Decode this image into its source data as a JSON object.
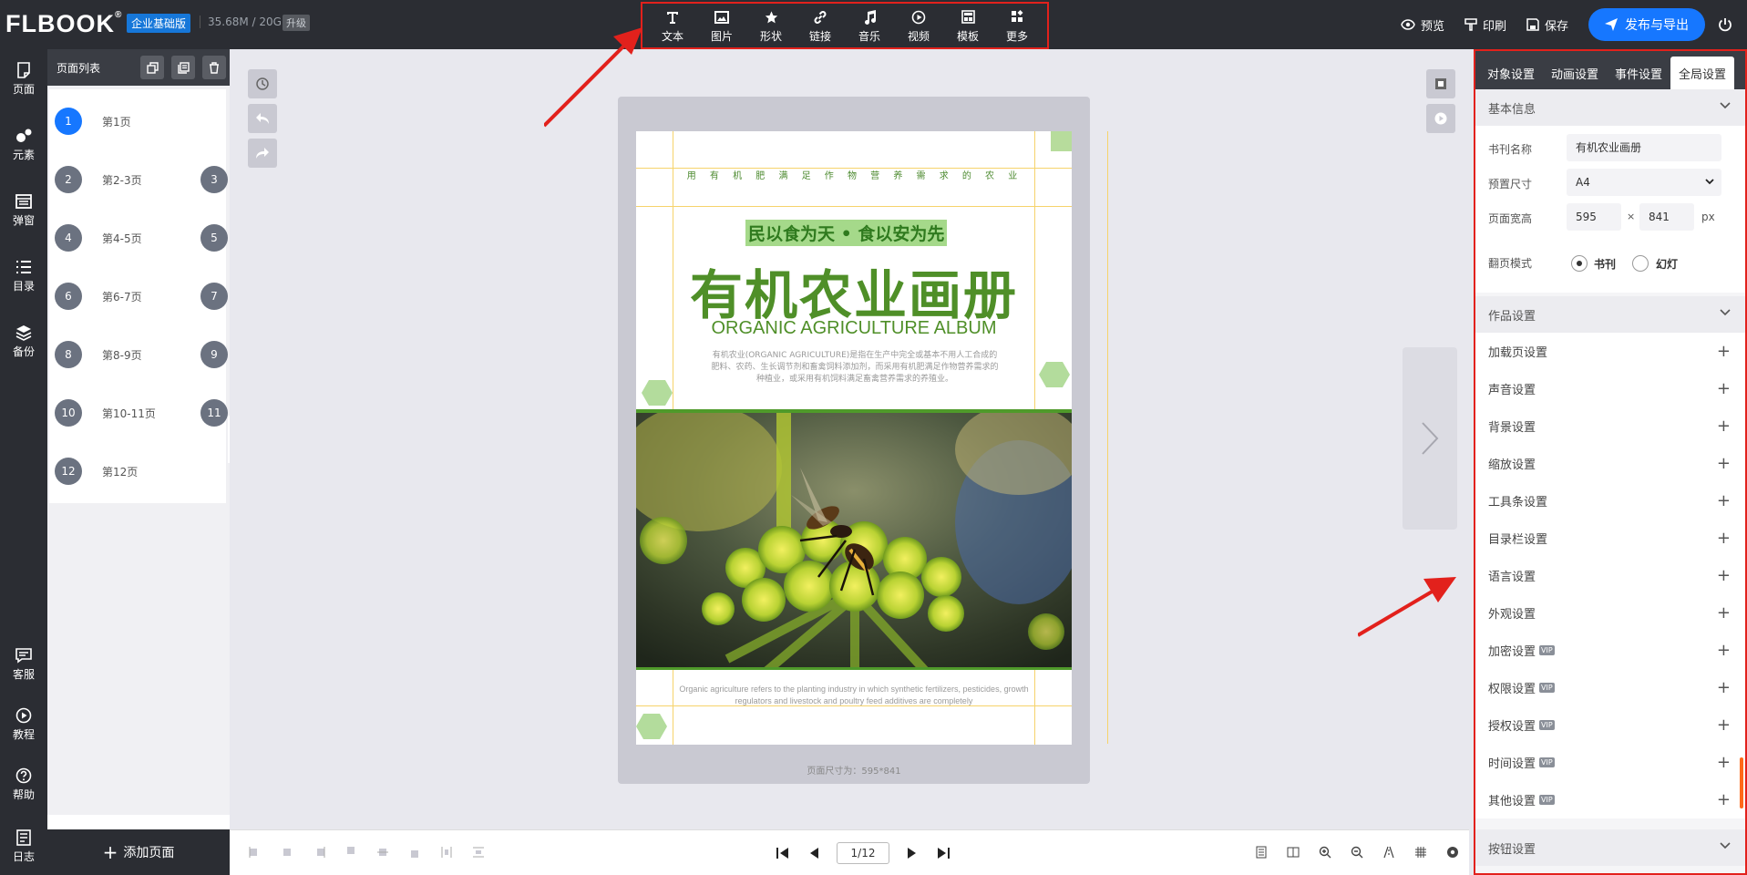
{
  "brand": {
    "logo": "FLBOOK",
    "edition": "企业基础版",
    "storage": "35.68M / 20G",
    "upgrade": "升级"
  },
  "toolbar": [
    {
      "label": "文本",
      "icon": "text-icon"
    },
    {
      "label": "图片",
      "icon": "image-icon"
    },
    {
      "label": "形状",
      "icon": "star-icon"
    },
    {
      "label": "链接",
      "icon": "link-icon"
    },
    {
      "label": "音乐",
      "icon": "music-icon"
    },
    {
      "label": "视频",
      "icon": "video-icon"
    },
    {
      "label": "模板",
      "icon": "template-icon"
    },
    {
      "label": "更多",
      "icon": "more-icon"
    }
  ],
  "actions": {
    "preview": "预览",
    "print": "印刷",
    "save": "保存",
    "publish": "发布与导出"
  },
  "leftnav": [
    {
      "label": "页面",
      "icon": "page-icon"
    },
    {
      "label": "元素",
      "icon": "elements-icon"
    },
    {
      "label": "弹窗",
      "icon": "popup-icon"
    },
    {
      "label": "目录",
      "icon": "list-icon"
    },
    {
      "label": "备份",
      "icon": "layers-icon"
    },
    {
      "label": "客服",
      "icon": "chat-icon"
    },
    {
      "label": "教程",
      "icon": "play-icon"
    },
    {
      "label": "帮助",
      "icon": "help-icon"
    },
    {
      "label": "日志",
      "icon": "log-icon"
    }
  ],
  "pagelist": {
    "title": "页面列表",
    "pages": [
      {
        "left": "1",
        "right": "",
        "label": "第1页"
      },
      {
        "left": "2",
        "right": "3",
        "label": "第2-3页"
      },
      {
        "left": "4",
        "right": "5",
        "label": "第4-5页"
      },
      {
        "left": "6",
        "right": "7",
        "label": "第6-7页"
      },
      {
        "left": "8",
        "right": "9",
        "label": "第8-9页"
      },
      {
        "left": "10",
        "right": "11",
        "label": "第10-11页"
      },
      {
        "left": "12",
        "right": "",
        "label": "第12页"
      }
    ],
    "add": "添加页面"
  },
  "page": {
    "topline": "用 有 机 肥 满 足 作 物 营 养 需 求 的 农 业",
    "slogan": "民以食为天 • 食以安为先",
    "title": "有机农业画册",
    "subtitle": "ORGANIC AGRICULTURE ALBUM",
    "desc": "有机农业(ORGANIC AGRICULTURE)是指在生产中完全或基本不用人工合成的肥料、农药、生长调节剂和畜禽饲料添加剂，而采用有机肥满足作物营养需求的种植业，或采用有机饲料满足畜禽营养需求的养殖业。",
    "footer": "Organic agriculture refers to the planting industry in which synthetic fertilizers, pesticides, growth regulators and livestock and poultry feed additives are completely",
    "size_label": "页面尺寸为：595*841"
  },
  "pager": {
    "current": "1/12"
  },
  "rightpanel": {
    "tabs": [
      "对象设置",
      "动画设置",
      "事件设置",
      "全局设置"
    ],
    "active_tab": 3,
    "basic": {
      "header": "基本信息",
      "name_label": "书刊名称",
      "name_value": "有机农业画册",
      "size_label": "预置尺寸",
      "size_value": "A4",
      "dim_label": "页面宽高",
      "width": "595",
      "height": "841",
      "times": "×",
      "unit": "px",
      "mode_label": "翻页模式",
      "mode_book": "书刊",
      "mode_slide": "幻灯"
    },
    "work_header": "作品设置",
    "settings": [
      {
        "label": "加载页设置",
        "vip": false
      },
      {
        "label": "声音设置",
        "vip": false
      },
      {
        "label": "背景设置",
        "vip": false
      },
      {
        "label": "缩放设置",
        "vip": false
      },
      {
        "label": "工具条设置",
        "vip": false
      },
      {
        "label": "目录栏设置",
        "vip": false
      },
      {
        "label": "语言设置",
        "vip": false
      },
      {
        "label": "外观设置",
        "vip": false
      },
      {
        "label": "加密设置",
        "vip": true
      },
      {
        "label": "权限设置",
        "vip": true
      },
      {
        "label": "授权设置",
        "vip": true
      },
      {
        "label": "时间设置",
        "vip": true
      },
      {
        "label": "其他设置",
        "vip": true
      }
    ],
    "vip_label": "VIP",
    "button_header": "按钮设置"
  },
  "colors": {
    "accent": "#1677ff",
    "annotation": "#e2211c",
    "green": "#4f8f28"
  }
}
